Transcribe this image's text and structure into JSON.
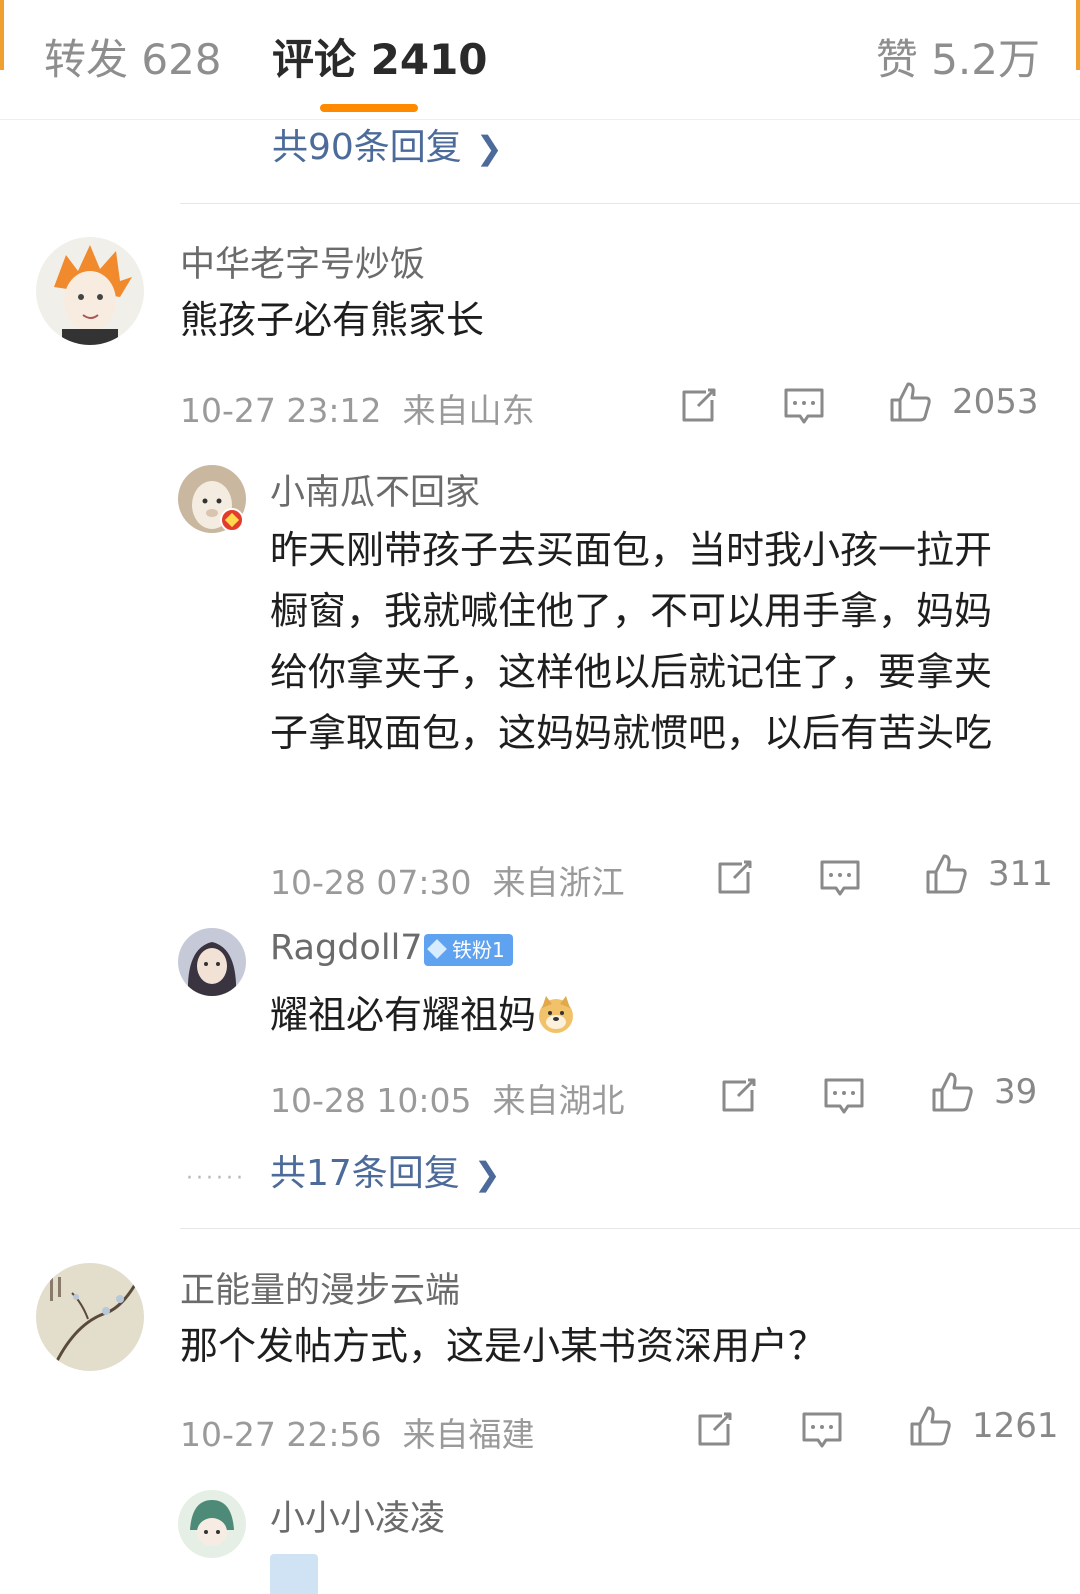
{
  "tabs": {
    "repost": "转发 628",
    "comments": "评论 2410",
    "likes": "赞 5.2万"
  },
  "colors": {
    "accent": "#ff8a00",
    "link": "#4d6b9a",
    "badge": "#5ea2f0"
  },
  "top_more_replies": "共90条回复",
  "comments": [
    {
      "user": "中华老字号炒饭",
      "text": "熊孩子必有熊家长",
      "time": "10-27 23:12",
      "location": "来自山东",
      "likes": "2053",
      "replies": [
        {
          "user": "小南瓜不回家",
          "text": "昨天刚带孩子去买面包，当时我小孩一拉开橱窗，我就喊住他了，不可以用手拿，妈妈给你拿夹子，这样他以后就记住了，要拿夹子拿取面包，这妈妈就惯吧，以后有苦头吃",
          "time": "10-28 07:30",
          "location": "来自浙江",
          "likes": "311"
        },
        {
          "user": "Ragdoll7",
          "badge": "铁粉1",
          "text": "耀祖必有耀祖妈",
          "emoji": "doge-emoji",
          "time": "10-28 10:05",
          "location": "来自湖北",
          "likes": "39"
        }
      ],
      "more_replies": "共17条回复"
    },
    {
      "user": "正能量的漫步云端",
      "text": "那个发帖方式，这是小某书资深用户？",
      "time": "10-27 22:56",
      "location": "来自福建",
      "likes": "1261",
      "replies": [
        {
          "user": "小小小凌凌"
        }
      ]
    }
  ],
  "icons": {
    "repost": "share-square-icon",
    "reply": "comment-bubble-icon",
    "like": "thumbs-up-icon",
    "more": "chevron-right-icon"
  }
}
